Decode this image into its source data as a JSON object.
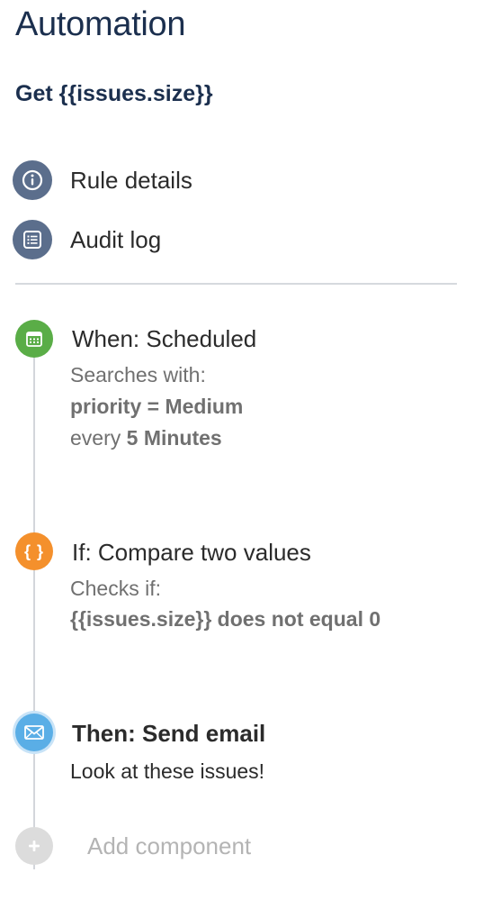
{
  "header": {
    "title": "Automation",
    "rule_name": "Get {{issues.size}}"
  },
  "nav": {
    "items": [
      {
        "label": "Rule details",
        "icon": "info-icon"
      },
      {
        "label": "Audit log",
        "icon": "list-icon"
      }
    ]
  },
  "steps": {
    "trigger": {
      "title": "When: Scheduled",
      "icon": "calendar-icon",
      "color": "#5aad47",
      "line1": "Searches with:",
      "line2": "priority = Medium",
      "line3_prefix": "every",
      "line3_value": "5 Minutes"
    },
    "condition": {
      "title": "If: Compare two values",
      "icon": "braces-icon",
      "icon_text": "{ }",
      "color": "#f4902c",
      "line1": "Checks if:",
      "line2": "{{issues.size}} does not equal 0"
    },
    "action": {
      "title": "Then: Send email",
      "icon": "envelope-icon",
      "color": "#5aaee6",
      "line1": "Look at these issues!"
    }
  },
  "add_component": {
    "label": "Add component",
    "icon": "plus-icon"
  }
}
